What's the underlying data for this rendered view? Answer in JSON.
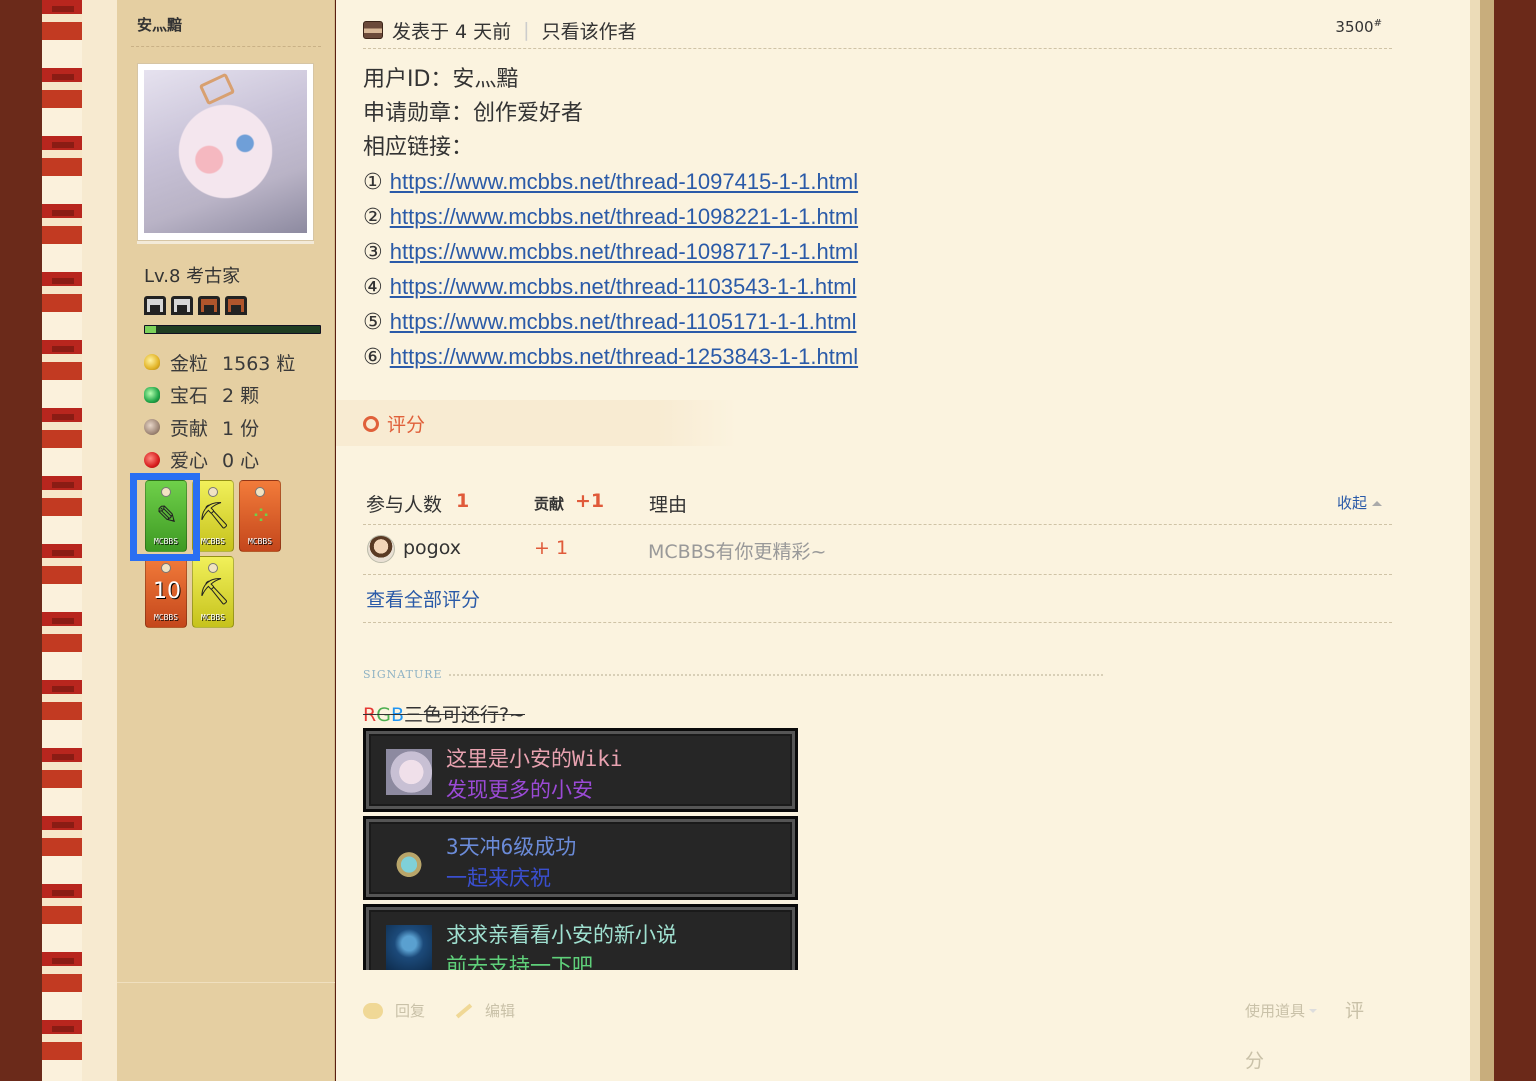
{
  "author": {
    "name": "安灬黯",
    "level": "Lv.8 考古家",
    "xp_fraction": 0.06,
    "stats": [
      {
        "icon": "gold-nugget-icon",
        "label": "金粒",
        "value": "1563 粒"
      },
      {
        "icon": "emerald-icon",
        "label": "宝石",
        "value": "2 颗"
      },
      {
        "icon": "contribution-icon",
        "label": "贡献",
        "value": "1 份"
      },
      {
        "icon": "apple-heart-icon",
        "label": "爱心",
        "value": "0 心"
      }
    ],
    "medal_tags": [
      "MCBBS",
      "MCBBS",
      "MCBBS",
      "MCBBS",
      "MCBBS"
    ]
  },
  "post": {
    "posted": "发表于 4 天前",
    "only_author": "只看该作者",
    "floor": "3500",
    "floor_mark": "#",
    "user_id_line": "用户ID：安灬黯",
    "badge_line": "申请勋章：创作爱好者",
    "links_label": "相应链接：",
    "links": [
      {
        "num": "①",
        "url": "https://www.mcbbs.net/thread-1097415-1-1.html"
      },
      {
        "num": "②",
        "url": "https://www.mcbbs.net/thread-1098221-1-1.html"
      },
      {
        "num": "③",
        "url": "https://www.mcbbs.net/thread-1098717-1-1.html"
      },
      {
        "num": "④",
        "url": "https://www.mcbbs.net/thread-1103543-1-1.html"
      },
      {
        "num": "⑤",
        "url": "https://www.mcbbs.net/thread-1105171-1-1.html"
      },
      {
        "num": "⑥",
        "url": "https://www.mcbbs.net/thread-1253843-1-1.html"
      }
    ]
  },
  "rating": {
    "title": "评分",
    "participants_label": "参与人数",
    "participants_count": "1",
    "contrib_label": "贡献",
    "contrib_total": "+1",
    "reason_label": "理由",
    "collapse": "收起",
    "rows": [
      {
        "user": "pogox",
        "value": "+ 1",
        "reason": "MCBBS有你更精彩~"
      }
    ],
    "view_all": "查看全部评分"
  },
  "signature": {
    "label": "SIGNATURE",
    "rgb_r": "R",
    "rgb_g": "G",
    "rgb_b": "B",
    "rgb_rest": "三色可还行?~",
    "panels": [
      {
        "line1": "这里是小安的Wiki",
        "line2": "发现更多的小安",
        "color1": "#e8a2b0",
        "color2": "#9b4ad6"
      },
      {
        "line1": "3天冲6级成功",
        "line2": "一起来庆祝",
        "color1": "#6b8bd8",
        "color2": "#3a4fd0"
      },
      {
        "line1": "求求亲看看小安的新小说",
        "line2": "前去支持一下吧",
        "color1": "#9fe0d0",
        "color2": "#5fd07a"
      }
    ]
  },
  "actions": {
    "reply": "回复",
    "edit": "编辑",
    "use_item": "使用道具",
    "rate_1": "评",
    "rate_2": "分"
  }
}
